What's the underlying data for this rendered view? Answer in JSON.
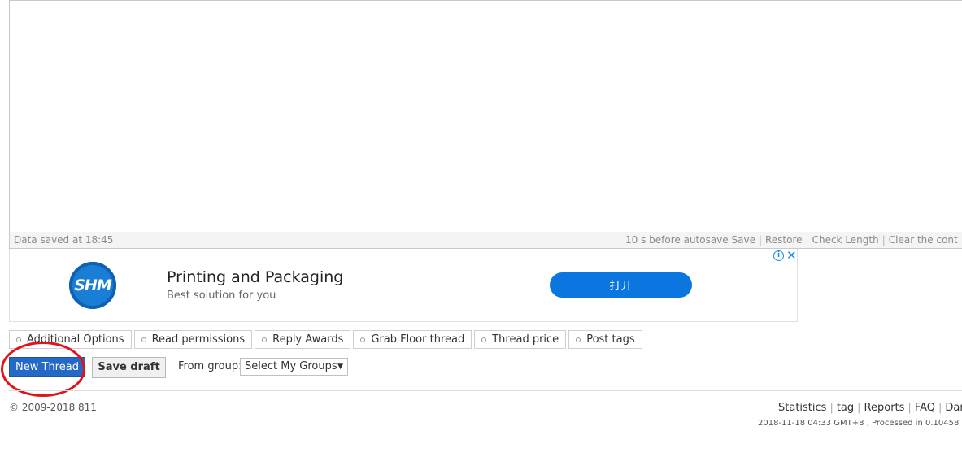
{
  "editor": {
    "status_left": "Data saved at 18:45",
    "status_links": [
      "10 s before autosave Save",
      "Restore",
      "Check Length",
      "Clear the cont"
    ]
  },
  "ad": {
    "logo_text": "SHM",
    "title": "Printing and Packaging",
    "subtitle": "Best solution for you",
    "button_label": "打开",
    "info_glyph": "i",
    "close_glyph": "✕"
  },
  "options": [
    "Additional Options",
    "Read permissions",
    "Reply Awards",
    "Grab Floor thread",
    "Thread price",
    "Post tags"
  ],
  "submit": {
    "new_thread_label": "New Thread",
    "save_draft_label": "Save draft",
    "group_label": "From group:",
    "group_select_value": "Select My Groups",
    "caret": "▼"
  },
  "footer": {
    "copyright": "© 2009-2018 811",
    "links": [
      "Statistics",
      "tag",
      "Reports",
      "FAQ",
      "Dark ro"
    ],
    "meta": "2018-11-18 04:33 GMT+8 , Processed in 0.10458"
  }
}
